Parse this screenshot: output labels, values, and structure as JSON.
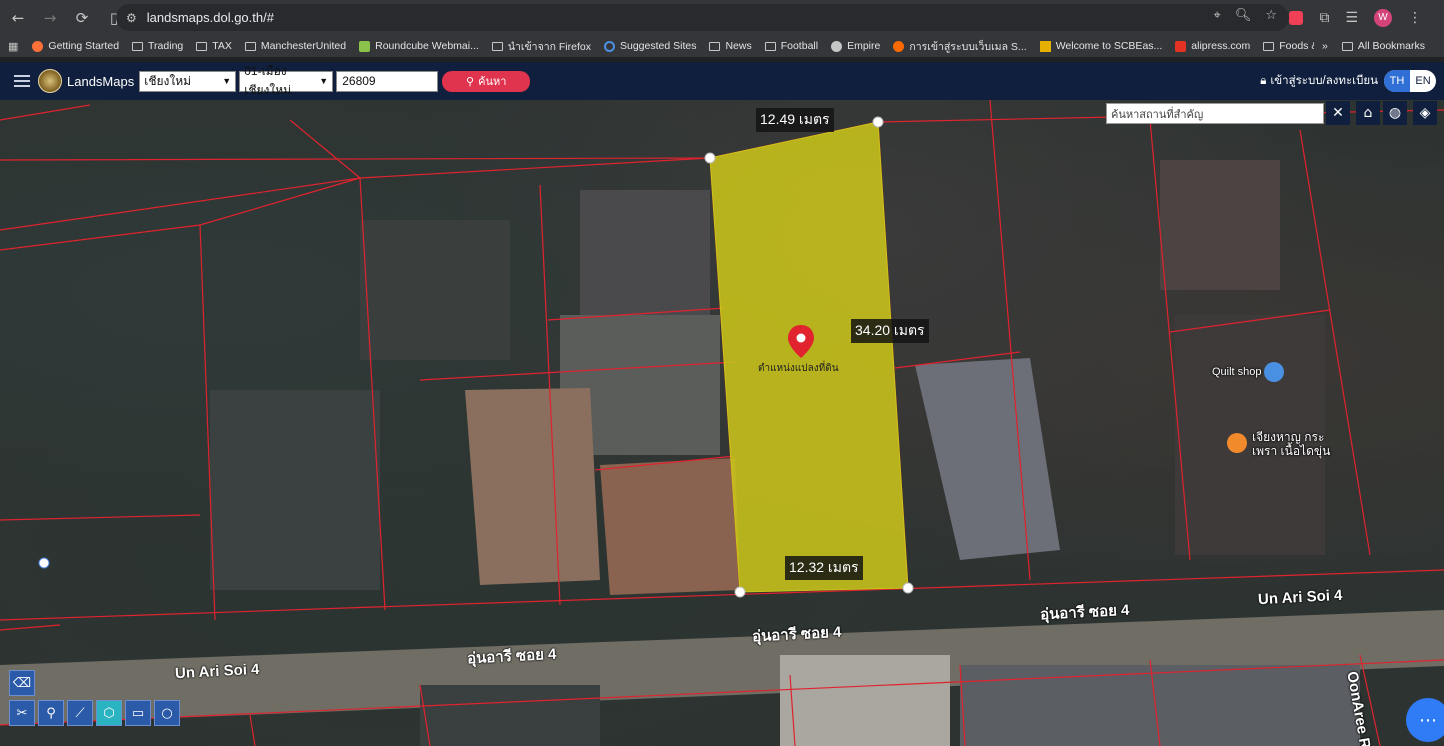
{
  "browser": {
    "url": "landsmaps.dol.go.th/#"
  },
  "bookmarks": {
    "items": [
      {
        "label": "Getting Started",
        "icon": "firefox-icon"
      },
      {
        "label": "Trading",
        "icon": "folder-icon"
      },
      {
        "label": "TAX",
        "icon": "folder-icon"
      },
      {
        "label": "ManchesterUnited",
        "icon": "folder-icon"
      },
      {
        "label": "Roundcube Webmai...",
        "icon": "roundcube-icon"
      },
      {
        "label": "นำเข้าจาก Firefox",
        "icon": "folder-icon"
      },
      {
        "label": "Suggested Sites",
        "icon": "search-icon"
      },
      {
        "label": "News",
        "icon": "folder-icon"
      },
      {
        "label": "Football",
        "icon": "folder-icon"
      },
      {
        "label": "Empire",
        "icon": "globe-icon"
      },
      {
        "label": "การเข้าสู่ระบบเว็บเมล S...",
        "icon": "link-icon"
      },
      {
        "label": "Welcome to SCBEas...",
        "icon": "scb-icon"
      },
      {
        "label": "alipress.com",
        "icon": "aliexpress-icon"
      },
      {
        "label": "Foods & Resturants",
        "icon": "folder-icon"
      }
    ],
    "all_bookmarks": "All Bookmarks",
    "overflow": "»"
  },
  "app": {
    "brand": "LandsMaps",
    "province": "เชียงใหม่",
    "district": "01-เมืองเชียงใหม่",
    "parcel_number": "26809",
    "search_label": "ค้นหา",
    "login_label": "เข้าสู่ระบบ/ลงทะเบียน",
    "lang_th": "TH",
    "lang_en": "EN"
  },
  "map": {
    "place_search_placeholder": "ค้นหาสถานที่สำคัญ",
    "dimensions": {
      "top": "12.49 เมตร",
      "right": "34.20 เมตร",
      "bottom": "12.32 เมตร"
    },
    "parcel_marker_label": "ตำแหน่งแปลงที่ดิน",
    "roads": {
      "r1": "Un Ari Soi 4",
      "r2": "อุ่นอารี ซอย 4",
      "r3": "Un Ari Soi 4",
      "r4": "อุ่นอารี ซอย 4",
      "r5": "Un Ari Soi 4",
      "r6": "OonAree R"
    },
    "pois": {
      "quilt": "Quilt shop",
      "restaurant": "เจียงหาญ กระเพรา เนื้อไดขุ่น"
    },
    "colors": {
      "parcel_fill": "#c9c41a",
      "boundary": "#e0232e",
      "accent": "#2f6fd6"
    }
  }
}
